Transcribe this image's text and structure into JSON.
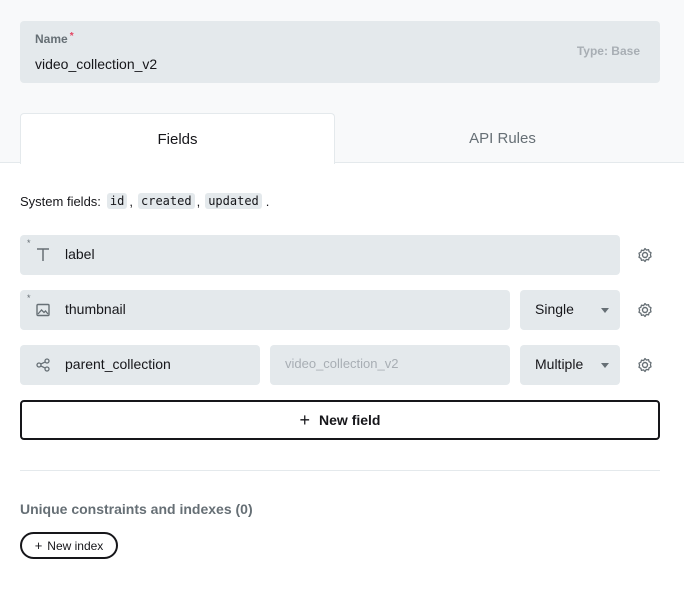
{
  "collection": {
    "name_label": "Name",
    "required_mark": "*",
    "name_value": "video_collection_v2",
    "type_hint": "Type: Base"
  },
  "tabs": [
    {
      "label": "Fields",
      "active": true
    },
    {
      "label": "API Rules",
      "active": false
    }
  ],
  "system_fields": {
    "prefix": "System fields:",
    "items": [
      "id",
      "created",
      "updated"
    ],
    "sep": ",",
    "end": "."
  },
  "fields": [
    {
      "name": "label",
      "icon": "text-icon",
      "required": true
    },
    {
      "name": "thumbnail",
      "icon": "image-icon",
      "required": true,
      "select": "Single"
    },
    {
      "name": "parent_collection",
      "icon": "relation-icon",
      "required": false,
      "relation_placeholder": "video_collection_v2",
      "select": "Multiple"
    }
  ],
  "required_dot": "*",
  "new_field_label": "New field",
  "plus_glyph": "+",
  "indexes": {
    "title": "Unique constraints and indexes (0)",
    "new_index_label": "New index"
  }
}
